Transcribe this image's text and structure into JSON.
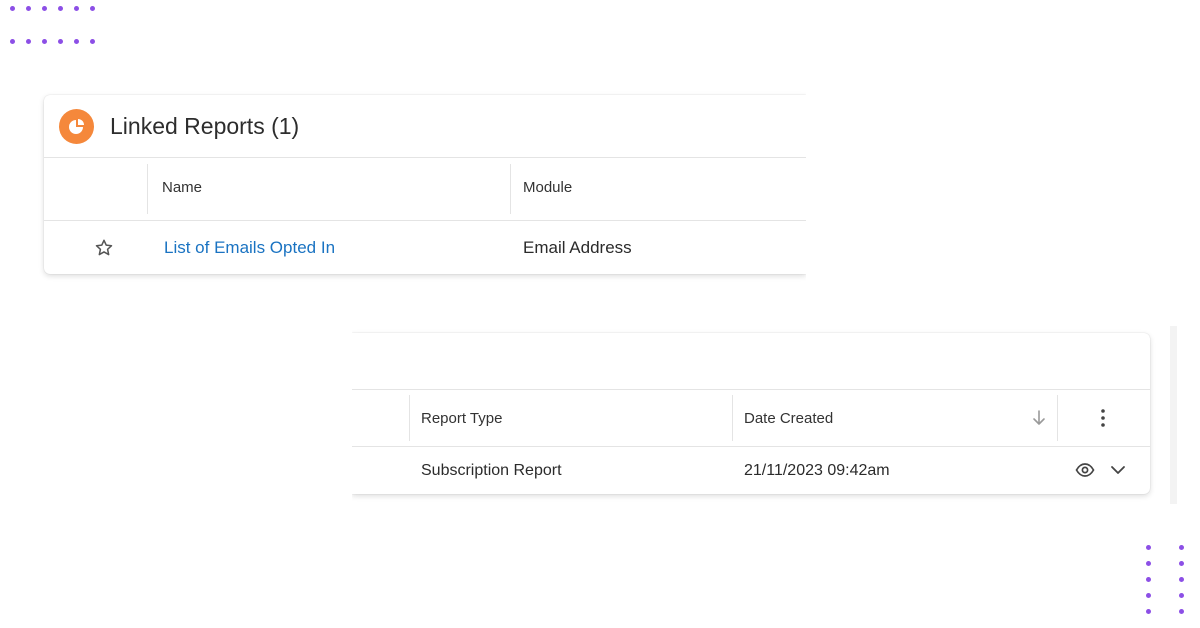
{
  "linked_reports": {
    "title": "Linked Reports (1)",
    "icon": "pie-chart-icon",
    "accent_color": "#f5883b",
    "columns": {
      "name": "Name",
      "module": "Module"
    },
    "row": {
      "name": "List of Emails Opted In",
      "module": "Email Address",
      "link_color": "#1a73c2"
    }
  },
  "report_details": {
    "columns": {
      "report_type": "Report Type",
      "date_created": "Date Created"
    },
    "row": {
      "report_type": "Subscription Report",
      "date_created": "21/11/2023 09:42am"
    },
    "icons": [
      "sort-desc-arrow-icon",
      "kebab-menu-icon",
      "eye-icon",
      "chevron-down-icon"
    ]
  },
  "decoration": {
    "dot_color": "#8c4fe6"
  }
}
